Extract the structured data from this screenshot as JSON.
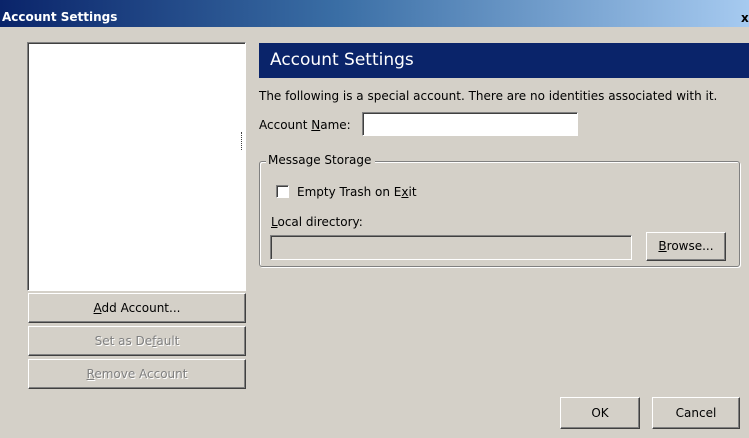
{
  "window": {
    "title": "Account Settings",
    "close_glyph": "x"
  },
  "sidebar": {
    "account_list_items": [],
    "add_account": {
      "pre": "",
      "key": "A",
      "post": "dd Account..."
    },
    "set_default": {
      "pre": "Set as De",
      "key": "f",
      "post": "ault"
    },
    "remove_account": {
      "pre": "",
      "key": "R",
      "post": "emove Account"
    }
  },
  "panel": {
    "header": "Account Settings",
    "description": "The following is a special account. There are no identities associated with it.",
    "account_name_label": {
      "pre": "Account ",
      "key": "N",
      "post": "ame:"
    },
    "account_name_value": "",
    "message_storage": {
      "legend": "Message Storage",
      "empty_trash": {
        "pre": "Empty Trash on E",
        "key": "x",
        "post": "it",
        "checked": false
      },
      "local_directory_label": {
        "pre": "",
        "key": "L",
        "post": "ocal directory:"
      },
      "local_directory_value": "",
      "browse": {
        "pre": "",
        "key": "B",
        "post": "rowse..."
      }
    }
  },
  "footer": {
    "ok": "OK",
    "cancel": "Cancel"
  },
  "colors": {
    "dialog_bg": "#d4d0c8",
    "header_bg": "#0a246a",
    "title_gradient_start": "#0a246a",
    "title_gradient_end": "#a6caf0",
    "disabled_text": "#808080"
  }
}
